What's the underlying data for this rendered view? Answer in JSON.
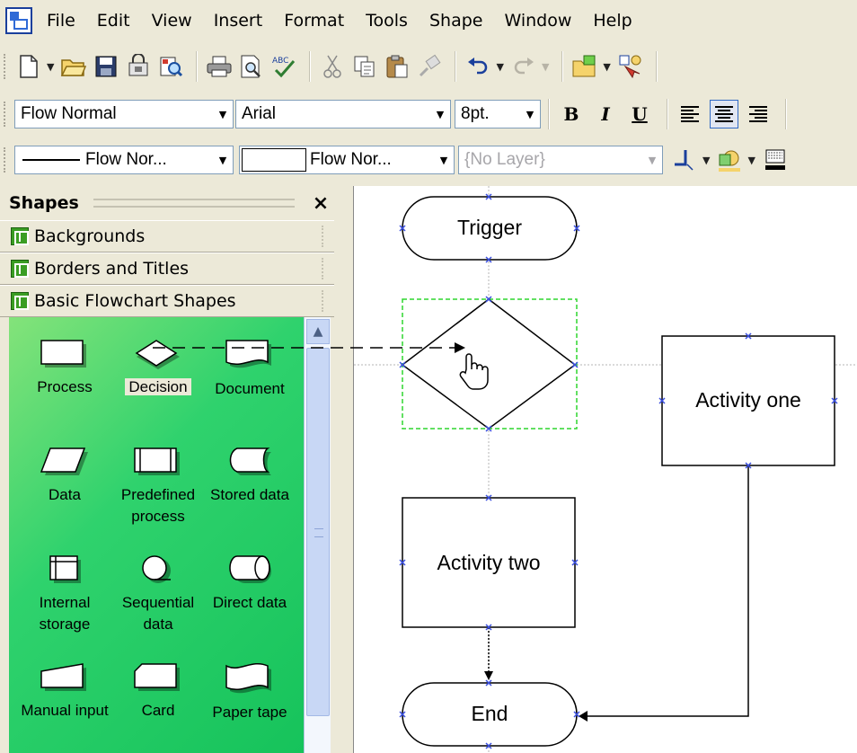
{
  "menu": {
    "items": [
      "File",
      "Edit",
      "View",
      "Insert",
      "Format",
      "Tools",
      "Shape",
      "Window",
      "Help"
    ]
  },
  "toolbar_standard": {
    "icons": [
      "new-icon",
      "open-icon",
      "save-icon",
      "permission-icon",
      "research-icon",
      "print-icon",
      "print-preview-icon",
      "spelling-icon",
      "cut-icon",
      "copy-icon",
      "paste-icon",
      "format-painter-icon",
      "undo-icon",
      "redo-icon",
      "shapes-menu-icon",
      "pointer-tool-icon"
    ]
  },
  "toolbar_formatting": {
    "style": "Flow Normal",
    "font": "Arial",
    "size": "8pt.",
    "bold": "B",
    "italic": "I",
    "underline": "U"
  },
  "toolbar_format_shape": {
    "line_style": "Flow Nor...",
    "fill_style": "Flow Nor...",
    "layer": "{No Layer}"
  },
  "shapes_pane": {
    "title": "Shapes",
    "close": "×",
    "stencils": [
      "Backgrounds",
      "Borders and Titles",
      "Basic Flowchart Shapes"
    ],
    "masters": [
      "Process",
      "Decision",
      "Document",
      "Data",
      "Predefined process",
      "Stored data",
      "Internal storage",
      "Sequential data",
      "Direct data",
      "Manual input",
      "Card",
      "Paper tape"
    ]
  },
  "canvas": {
    "shapes": {
      "trigger": "Trigger",
      "activity_one": "Activity one",
      "activity_two": "Activity two",
      "end": "End"
    }
  }
}
